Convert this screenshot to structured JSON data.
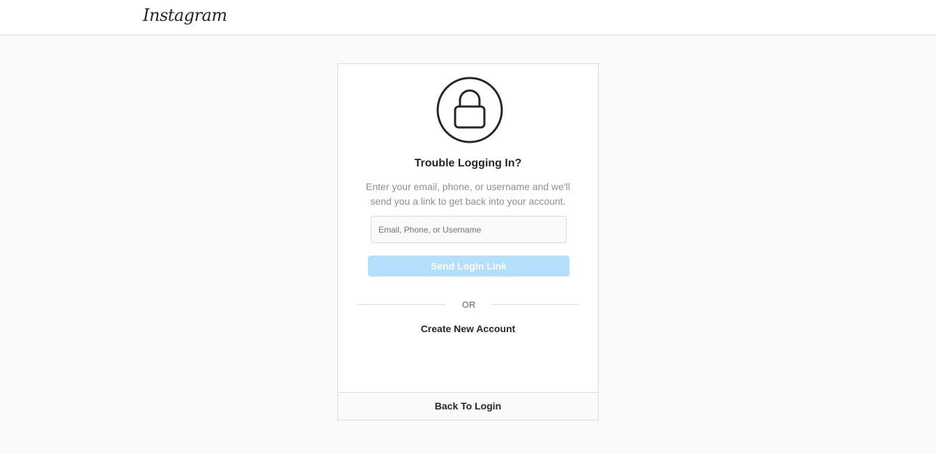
{
  "header": {
    "logo_text": "Instagram"
  },
  "card": {
    "icon": "lock-icon",
    "title": "Trouble Logging In?",
    "description": "Enter your email, phone, or username and we'll send you a link to get back into your account.",
    "input": {
      "value": "",
      "placeholder": "Email, Phone, or Username"
    },
    "send_button_label": "Send Login Link",
    "divider_label": "OR",
    "create_account_label": "Create New Account",
    "back_to_login_label": "Back To Login"
  },
  "colors": {
    "page_background": "#fafafa",
    "border": "#dbdbdb",
    "send_button_disabled": "#b2dffc",
    "text_primary": "#262626",
    "text_secondary": "#8e8e8e"
  }
}
